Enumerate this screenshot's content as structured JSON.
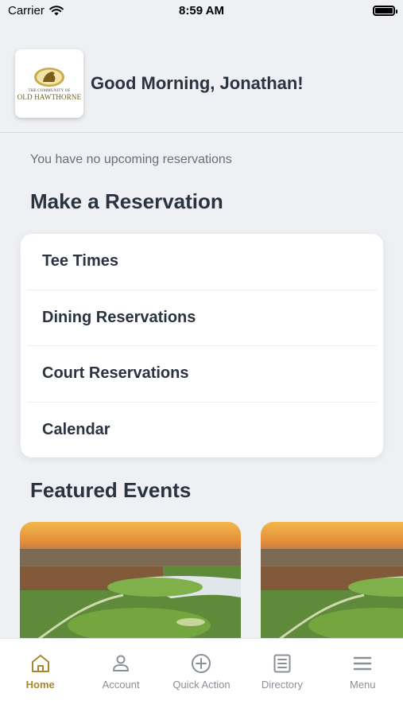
{
  "status": {
    "carrier": "Carrier",
    "time": "8:59 AM"
  },
  "logo": {
    "line1": "THE COMMUNITY OF",
    "line2": "OLD HAWTHORNE"
  },
  "header": {
    "greeting": "Good Morning, Jonathan!"
  },
  "reservations": {
    "empty_text": "You have no upcoming reservations"
  },
  "make_reservation": {
    "title": "Make a Reservation",
    "items": [
      {
        "label": "Tee Times"
      },
      {
        "label": "Dining Reservations"
      },
      {
        "label": "Court Reservations"
      },
      {
        "label": "Calendar"
      }
    ]
  },
  "featured_events": {
    "title": "Featured Events"
  },
  "tabs": [
    {
      "label": "Home",
      "icon": "home-icon",
      "active": true
    },
    {
      "label": "Account",
      "icon": "account-icon",
      "active": false
    },
    {
      "label": "Quick Action",
      "icon": "plus-circle-icon",
      "active": false
    },
    {
      "label": "Directory",
      "icon": "directory-icon",
      "active": false
    },
    {
      "label": "Menu",
      "icon": "menu-icon",
      "active": false
    }
  ],
  "colors": {
    "accent": "#a6882f",
    "background": "#eef0f4",
    "text": "#2b3240",
    "muted": "#8a8f98"
  }
}
